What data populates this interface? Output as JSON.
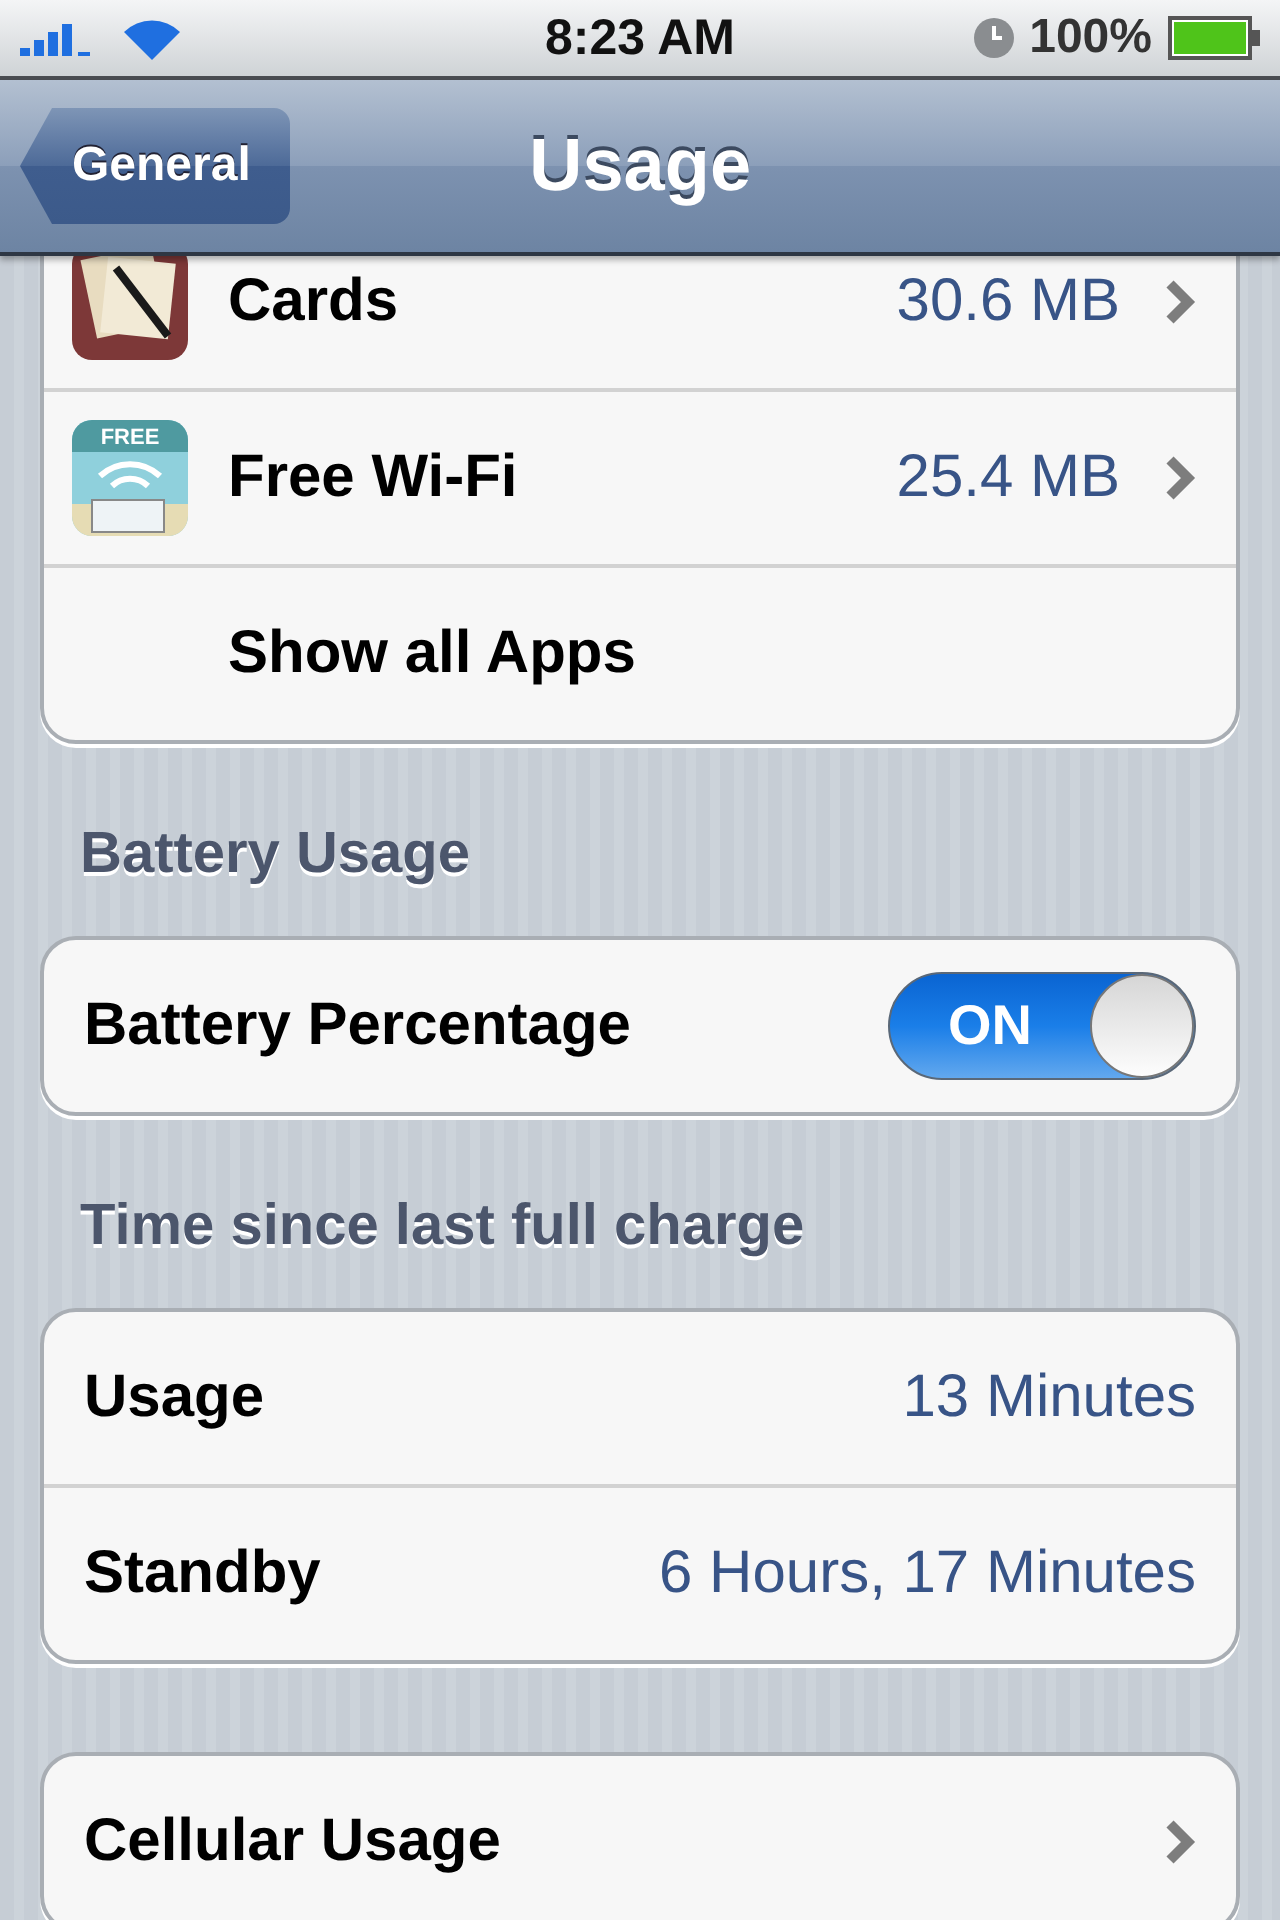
{
  "status_bar": {
    "time": "8:23 AM",
    "battery": "100%"
  },
  "nav": {
    "back": "General",
    "title": "Usage"
  },
  "sections": [
    {
      "rows": [
        {
          "kind": "app",
          "label": "Cards",
          "value": "30.6 MB"
        },
        {
          "kind": "app",
          "label": "Free Wi-Fi",
          "value": "25.4 MB",
          "icon_text": "FREE"
        },
        {
          "kind": "indented",
          "label": "Show all Apps"
        }
      ]
    },
    {
      "header": "Battery Usage",
      "rows": [
        {
          "kind": "toggle",
          "label": "Battery Percentage",
          "on": true,
          "on_label": "ON"
        }
      ]
    },
    {
      "header": "Time since last full charge",
      "rows": [
        {
          "kind": "value",
          "label": "Usage",
          "value": "13 Minutes"
        },
        {
          "kind": "value",
          "label": "Standby",
          "value": "6 Hours, 17 Minutes"
        }
      ]
    },
    {
      "rows": [
        {
          "kind": "nav",
          "label": "Cellular Usage"
        }
      ]
    }
  ]
}
